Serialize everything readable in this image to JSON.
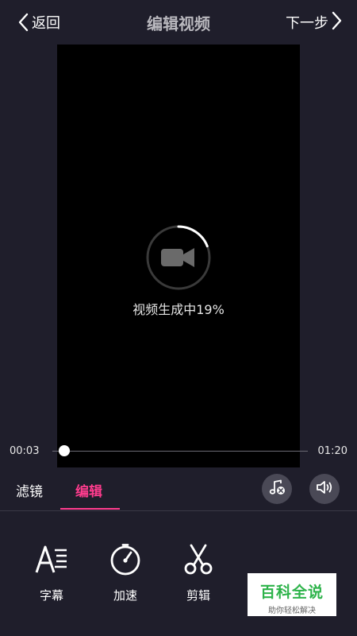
{
  "header": {
    "back_label": "返回",
    "title": "编辑视频",
    "next_label": "下一步"
  },
  "preview": {
    "status_text": "视频生成中19%",
    "progress": 0.19
  },
  "timeline": {
    "current_time": "00:03",
    "total_time": "01:20",
    "position": 0.0375
  },
  "tabs": [
    {
      "label": "滤镜",
      "selected": false
    },
    {
      "label": "编辑",
      "selected": true
    }
  ],
  "tools": [
    {
      "label": "字幕",
      "icon": "subtitle-icon"
    },
    {
      "label": "加速",
      "icon": "speedometer-icon"
    },
    {
      "label": "剪辑",
      "icon": "scissors-icon"
    }
  ],
  "watermark": {
    "title": "百科全说",
    "subtitle": "助你轻松解决"
  },
  "colors": {
    "background": "#1f1e2b",
    "accent": "#ff3c8e",
    "title": "#b9b8be",
    "button_bg": "#4a4956"
  }
}
